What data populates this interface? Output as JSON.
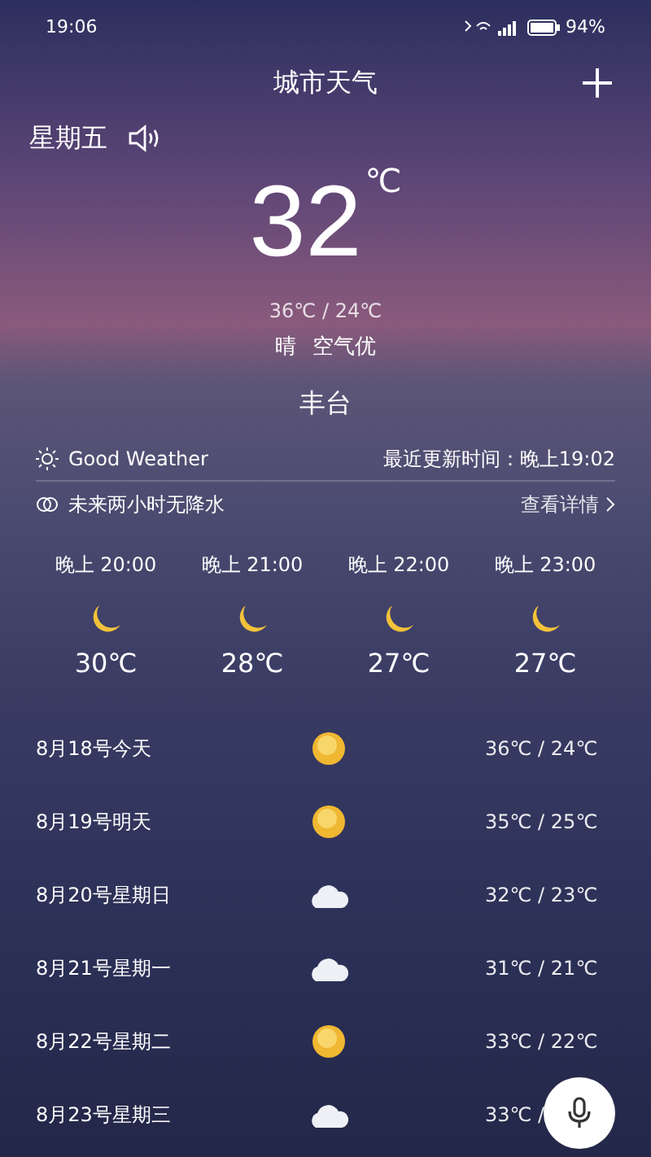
{
  "status_bar": {
    "time": "19:06",
    "battery": "94%"
  },
  "header": {
    "title": "城市天气"
  },
  "weekday": "星期五",
  "current": {
    "temp": "32",
    "unit": "℃",
    "range": "36℃ / 24℃",
    "condition": "晴",
    "air": "空气优"
  },
  "city": "丰台",
  "info": {
    "summary": "Good Weather",
    "updated": "最近更新时间：晚上19:02",
    "rain": "未来两小时无降水",
    "details": "查看详情"
  },
  "hourly": [
    {
      "time": "晚上 20:00",
      "kind": "moon",
      "temp": "30℃"
    },
    {
      "time": "晚上 21:00",
      "kind": "moon",
      "temp": "28℃"
    },
    {
      "time": "晚上 22:00",
      "kind": "moon",
      "temp": "27℃"
    },
    {
      "time": "晚上 23:00",
      "kind": "moon",
      "temp": "27℃"
    }
  ],
  "daily": [
    {
      "date": "8月18号今天",
      "kind": "sun",
      "temp": "36℃ / 24℃"
    },
    {
      "date": "8月19号明天",
      "kind": "sun",
      "temp": "35℃ / 25℃"
    },
    {
      "date": "8月20号星期日",
      "kind": "cloud",
      "temp": "32℃ / 23℃"
    },
    {
      "date": "8月21号星期一",
      "kind": "cloud",
      "temp": "31℃ / 21℃"
    },
    {
      "date": "8月22号星期二",
      "kind": "sun",
      "temp": "33℃ / 22℃"
    },
    {
      "date": "8月23号星期三",
      "kind": "cloud",
      "temp": "33℃ /"
    }
  ]
}
